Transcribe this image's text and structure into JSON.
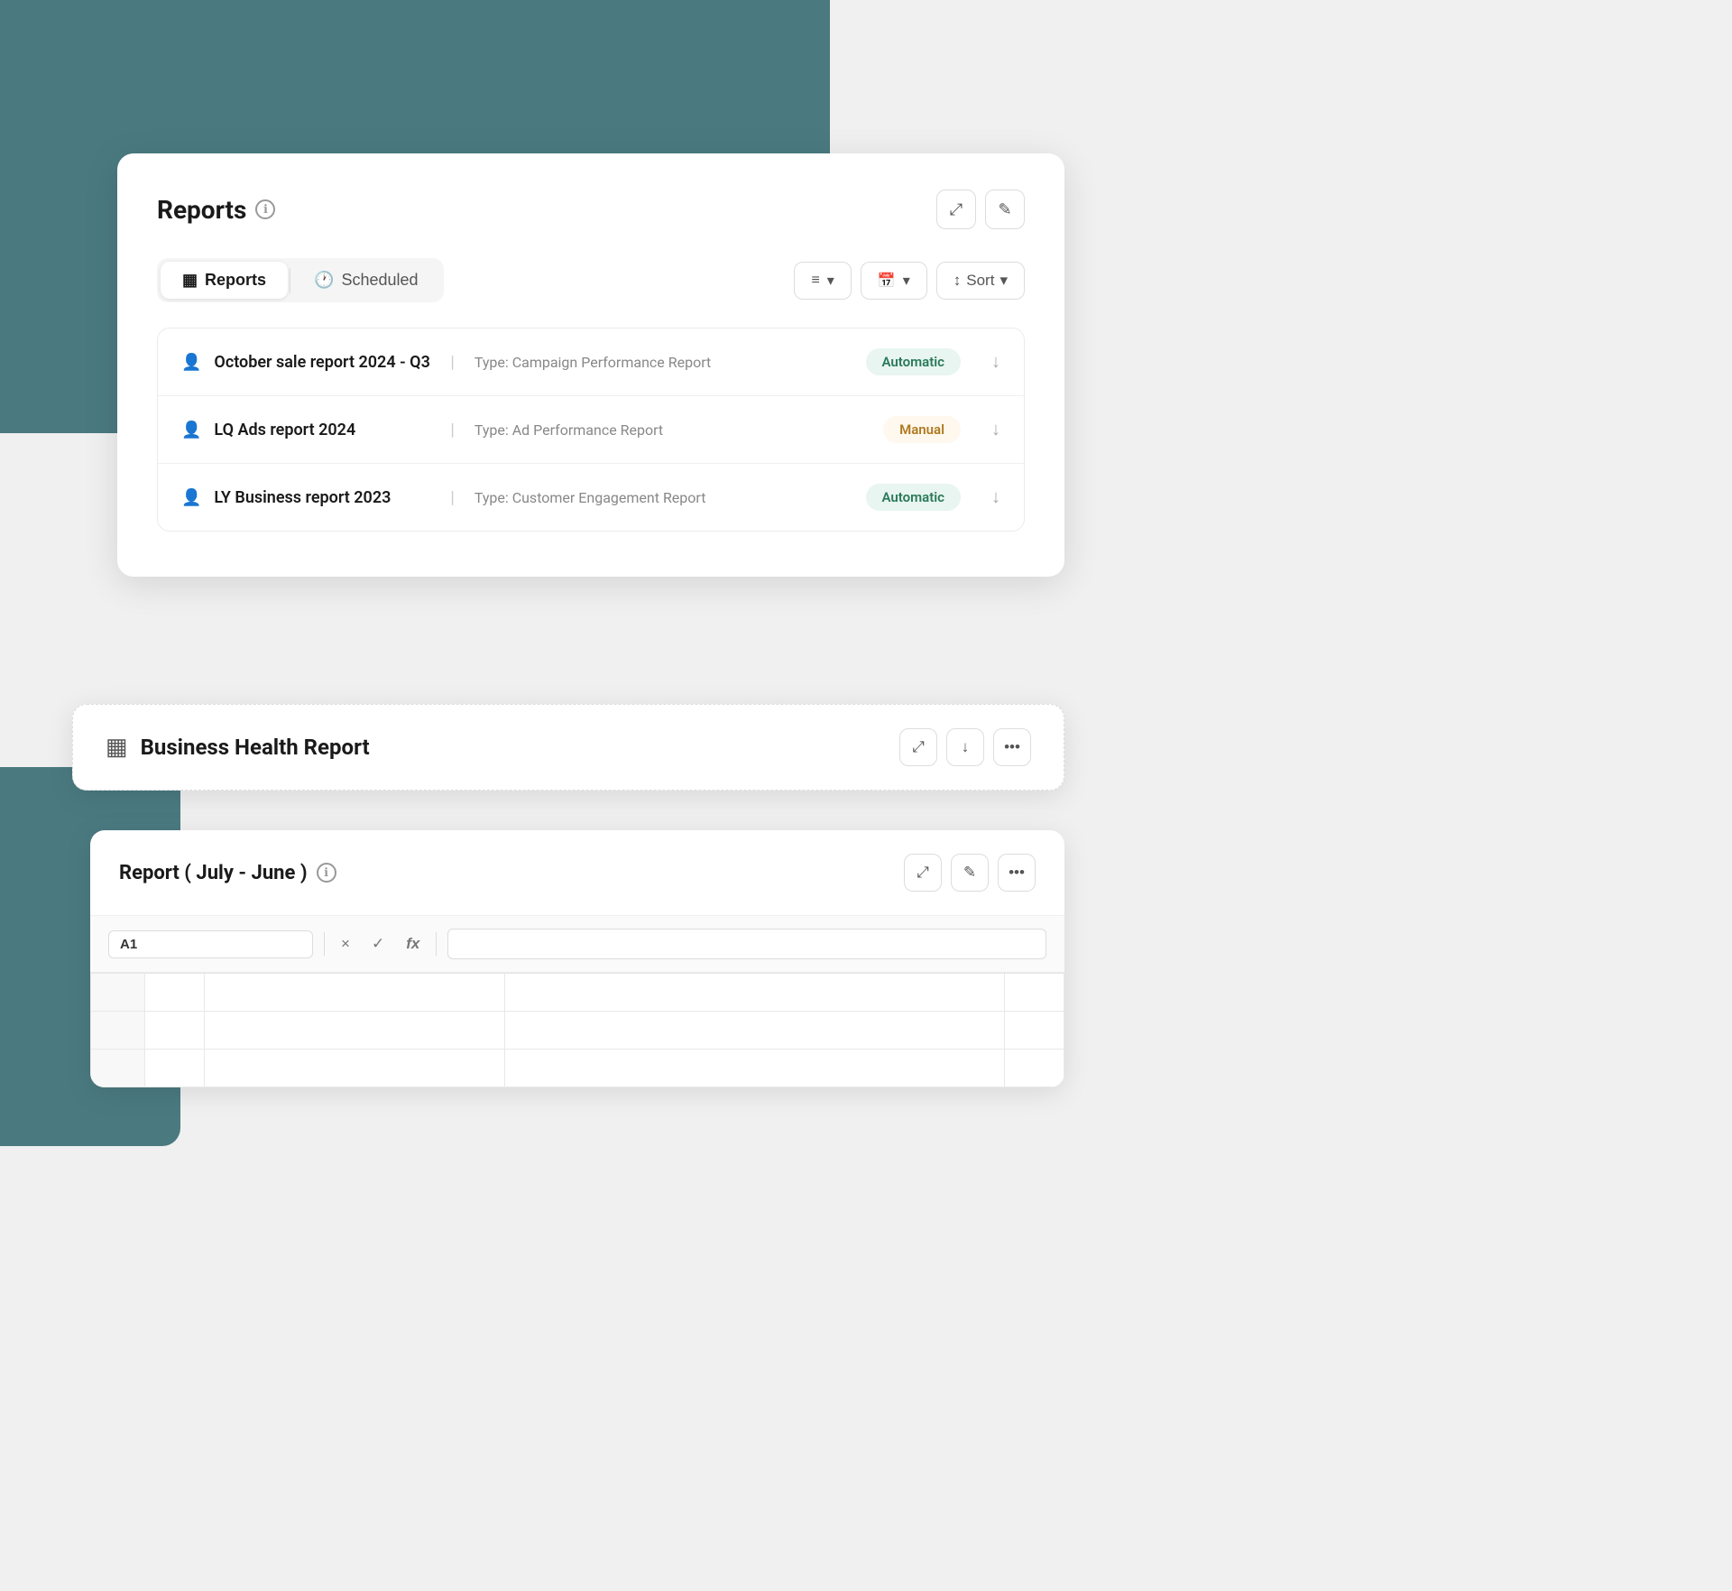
{
  "background": {
    "teal_color": "#4a7a80"
  },
  "reports_card": {
    "title": "Reports",
    "info_icon": "ℹ",
    "expand_icon": "⤢",
    "edit_icon": "✎",
    "tabs": [
      {
        "id": "reports",
        "label": "Reports",
        "icon": "▦",
        "active": true
      },
      {
        "id": "scheduled",
        "label": "Scheduled",
        "icon": "🕐",
        "active": false
      }
    ],
    "filter_icon": "≡",
    "calendar_icon": "📅",
    "sort_label": "Sort",
    "sort_icon": "↕",
    "reports": [
      {
        "name": "October sale report 2024 - Q3",
        "type": "Type: Campaign Performance Report",
        "badge": "Automatic",
        "badge_type": "automatic"
      },
      {
        "name": "LQ Ads report 2024",
        "type": "Type: Ad Performance Report",
        "badge": "Manual",
        "badge_type": "manual"
      },
      {
        "name": "LY Business report 2023",
        "type": "Type: Customer Engagement Report",
        "badge": "Automatic",
        "badge_type": "automatic"
      }
    ]
  },
  "health_card": {
    "title": "Business Health Report",
    "icon": "▦",
    "expand_icon": "⤢",
    "download_icon": "↓",
    "dots_icon": "•••"
  },
  "report_july_card": {
    "title": "Report ( July - June )",
    "info_icon": "ℹ",
    "expand_icon": "⤢",
    "edit_icon": "✎",
    "dots_icon": "•••",
    "cell_ref": "A1",
    "cancel_icon": "×",
    "check_icon": "✓",
    "fx_label": "fx",
    "formula_placeholder": "",
    "grid_rows": 3,
    "grid_cols": 4
  }
}
